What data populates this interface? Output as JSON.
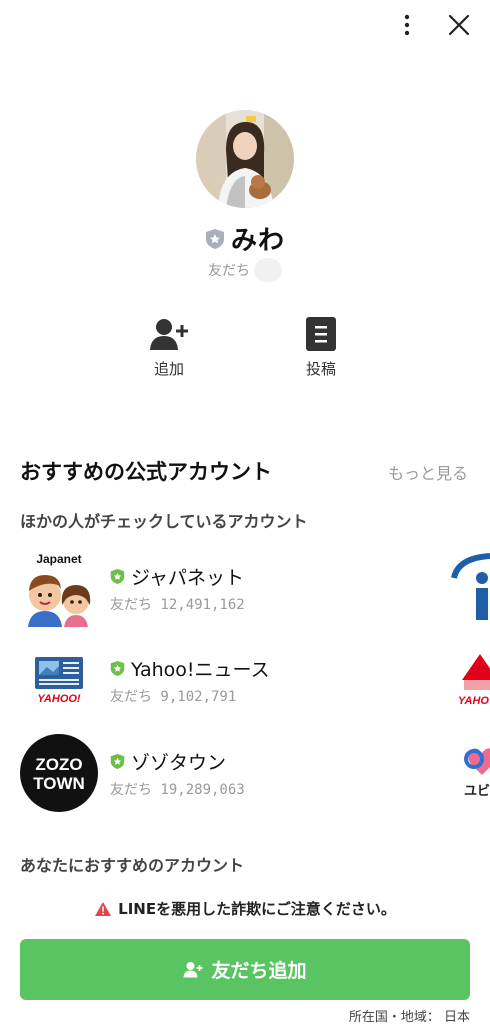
{
  "profile": {
    "name": "みわ",
    "friend_status": "友だち"
  },
  "actions": {
    "add_label": "追加",
    "post_label": "投稿"
  },
  "recommended": {
    "title": "おすすめの公式アカウント",
    "see_more": "もっと見る",
    "others_checking": "ほかの人がチェックしているアカウント",
    "accounts": [
      {
        "name": "ジャパネット",
        "friends": "友だち 12,491,162",
        "logo_text": "Japanet"
      },
      {
        "name": "Yahoo!ニュース",
        "friends": "友だち 9,102,791",
        "logo_text": "YAHOO!"
      },
      {
        "name": "ゾゾタウン",
        "friends": "友だち 19,289,063",
        "logo_text_1": "ZOZO",
        "logo_text_2": "TOWN"
      }
    ],
    "peek_texts": [
      "YAHO",
      "ユビ"
    ],
    "for_you": "あなたにおすすめのアカウント"
  },
  "warning": {
    "text": "LINEを悪用した詐欺にご注意ください。"
  },
  "add_friend_button": {
    "label": "友だち追加"
  },
  "footer": {
    "region": "所在国・地域： 日本"
  },
  "colors": {
    "accent_green": "#5ac463",
    "badge_green": "#6cbf4a",
    "badge_gray": "#a8aebb",
    "warning_red": "#e0454a"
  }
}
